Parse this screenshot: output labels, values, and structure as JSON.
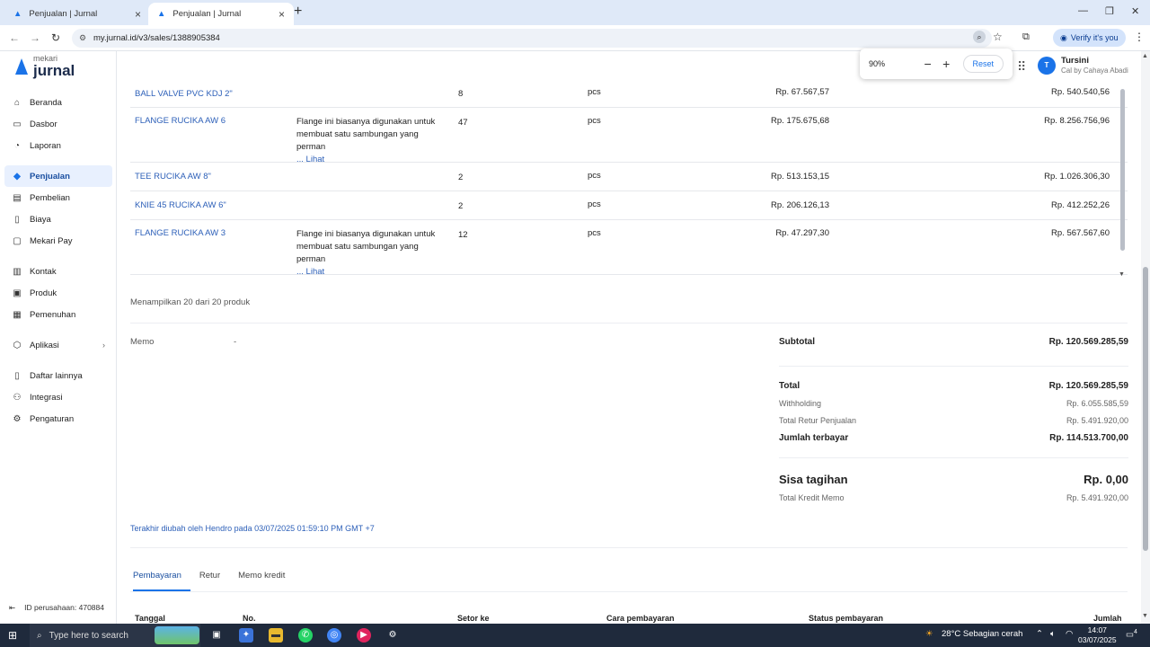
{
  "browser": {
    "tabs": [
      {
        "title": "Penjualan | Jurnal"
      },
      {
        "title": "Penjualan | Jurnal"
      }
    ],
    "url": "my.jurnal.id/v3/sales/1388905384",
    "verify_label": "Verify it's you",
    "zoom": {
      "percent": "90%",
      "reset_label": "Reset"
    }
  },
  "app": {
    "logo_top": "mekari",
    "logo_main": "jurnal",
    "user": {
      "initial": "T",
      "name": "Tursini",
      "company": "Cal by Cahaya Abadi"
    },
    "sidebar": [
      {
        "label": "Beranda",
        "icon": "home-icon"
      },
      {
        "label": "Dasbor",
        "icon": "dashboard-icon"
      },
      {
        "label": "Laporan",
        "icon": "report-icon"
      },
      {
        "label": "Penjualan",
        "icon": "sales-icon"
      },
      {
        "label": "Pembelian",
        "icon": "purchase-icon"
      },
      {
        "label": "Biaya",
        "icon": "expense-icon"
      },
      {
        "label": "Mekari Pay",
        "icon": "pay-icon"
      },
      {
        "label": "Kontak",
        "icon": "contact-icon"
      },
      {
        "label": "Produk",
        "icon": "product-icon"
      },
      {
        "label": "Pemenuhan",
        "icon": "fulfillment-icon"
      },
      {
        "label": "Aplikasi",
        "icon": "apps-icon"
      },
      {
        "label": "Daftar lainnya",
        "icon": "list-icon"
      },
      {
        "label": "Integrasi",
        "icon": "integration-icon"
      },
      {
        "label": "Pengaturan",
        "icon": "settings-icon"
      }
    ],
    "company_id": "ID perusahaan: 470884"
  },
  "products": [
    {
      "name": "BALL VALVE PVC KDJ 2\"",
      "desc": "",
      "more": "",
      "qty": "8",
      "unit": "pcs",
      "price": "Rp. 67.567,57",
      "amount": "Rp. 540.540,56"
    },
    {
      "name": "FLANGE RUCIKA AW 6",
      "desc": "Flange ini biasanya digunakan untuk membuat satu sambungan yang perman",
      "more": "... Lihat",
      "qty": "47",
      "unit": "pcs",
      "price": "Rp. 175.675,68",
      "amount": "Rp. 8.256.756,96"
    },
    {
      "name": "TEE RUCIKA AW 8\"",
      "desc": "",
      "more": "",
      "qty": "2",
      "unit": "pcs",
      "price": "Rp. 513.153,15",
      "amount": "Rp. 1.026.306,30"
    },
    {
      "name": "KNIE 45 RUCIKA AW 6\"",
      "desc": "",
      "more": "",
      "qty": "2",
      "unit": "pcs",
      "price": "Rp. 206.126,13",
      "amount": "Rp. 412.252,26"
    },
    {
      "name": "FLANGE RUCIKA AW 3",
      "desc": "Flange ini biasanya digunakan untuk membuat satu sambungan yang perman",
      "more": "... Lihat",
      "qty": "12",
      "unit": "pcs",
      "price": "Rp. 47.297,30",
      "amount": "Rp. 567.567,60"
    }
  ],
  "showing": "Menampilkan 20 dari 20 produk",
  "memo": {
    "label": "Memo",
    "value": "-"
  },
  "summary": {
    "subtotal_label": "Subtotal",
    "subtotal": "Rp. 120.569.285,59",
    "total_label": "Total",
    "total": "Rp. 120.569.285,59",
    "withholding_label": "Withholding",
    "withholding": "Rp. 6.055.585,59",
    "retur_label": "Total Retur Penjualan",
    "retur": "Rp. 5.491.920,00",
    "paid_label": "Jumlah terbayar",
    "paid": "Rp. 114.513.700,00",
    "due_label": "Sisa tagihan",
    "due": "Rp. 0,00",
    "credit_label": "Total Kredit Memo",
    "credit": "Rp. 5.491.920,00"
  },
  "last_updated": "Terakhir diubah oleh Hendro pada 03/07/2025 01:59:10 PM GMT +7",
  "bottom_tabs": [
    "Pembayaran",
    "Retur",
    "Memo kredit"
  ],
  "payment_headers": [
    "Tanggal",
    "No.",
    "Setor ke",
    "Cara pembayaran",
    "Status pembayaran",
    "Jumlah"
  ],
  "taskbar": {
    "search_placeholder": "Type here to search",
    "weather": "28°C  Sebagian cerah",
    "time": "14:07",
    "date": "03/07/2025",
    "notif_count": "4"
  }
}
